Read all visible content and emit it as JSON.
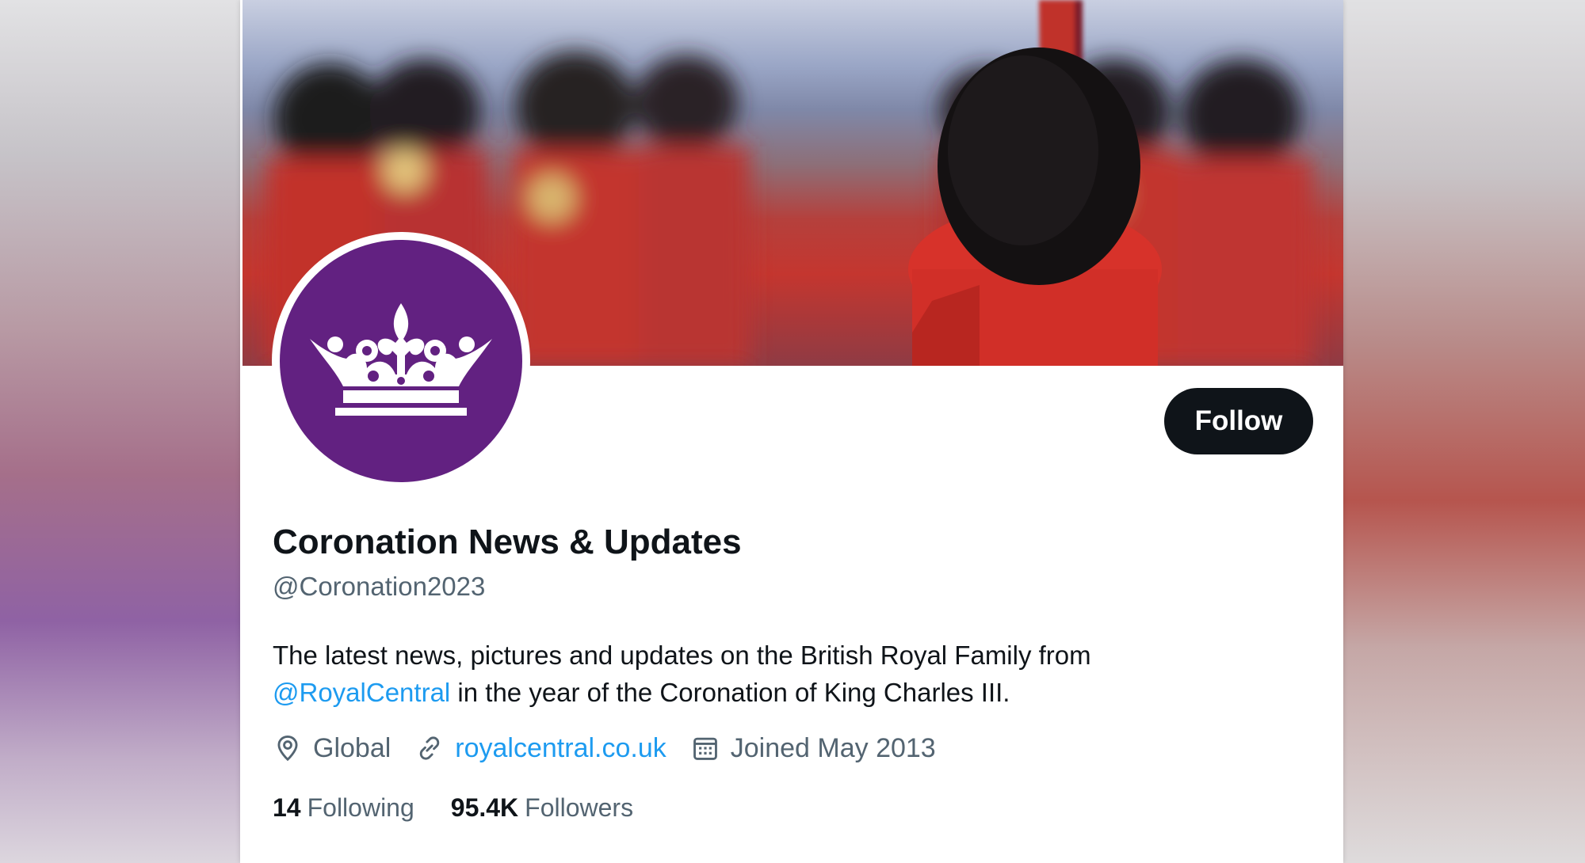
{
  "profile": {
    "display_name": "Coronation News & Updates",
    "handle": "@Coronation2023",
    "bio_prefix": "The latest news, pictures and updates on the British Royal Family  from ",
    "bio_mention": "@RoyalCentral",
    "bio_suffix": " in the year of the Coronation of King Charles III.",
    "location": "Global",
    "website": "royalcentral.co.uk",
    "joined": "Joined May 2013"
  },
  "actions": {
    "follow_label": "Follow"
  },
  "stats": {
    "following_count": "14",
    "following_label": "Following",
    "followers_count": "95.4K",
    "followers_label": "Followers"
  },
  "icons": {
    "location": "location-pin-icon",
    "website": "link-icon",
    "joined": "calendar-icon",
    "avatar": "crown-icon"
  },
  "colors": {
    "avatar_bg": "#622181",
    "follow_bg": "#0f1419",
    "link": "#1d9bf0",
    "muted_text": "#536471"
  }
}
